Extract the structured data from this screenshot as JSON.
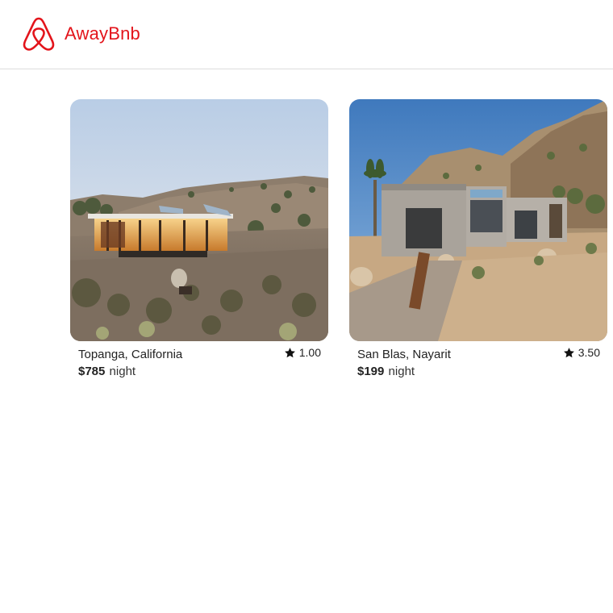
{
  "app": {
    "brand": "AwayBnb",
    "brand_color": "#e3141b"
  },
  "listings": [
    {
      "location": "Topanga, California",
      "rating": "1.00",
      "price": "$785",
      "unit": "night",
      "image": "modern glass desert house at dusk"
    },
    {
      "location": "San Blas, Nayarit",
      "rating": "3.50",
      "price": "$199",
      "unit": "night",
      "image": "concrete desert villa with rocky hills"
    }
  ]
}
